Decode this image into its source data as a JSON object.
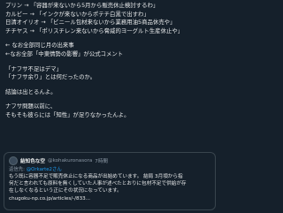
{
  "post": {
    "lines": [
      "プリン → 「容器が来ないから5月から販売休止検討するわ」",
      "カルビー → 「インクが来ないからポテチ白黒で出すわ」",
      "日清オイリオ → 「ビニール包材来ないから業務用油5商品休売や」",
      "チチヤス → 「ポリスチレン来ないから脅威的ヨーグルト生産休止や」",
      "",
      "← なお全部同じ月の出来事",
      "←なお全部「中東情勢の影響」が公式コメント",
      "",
      "「ナフサ不足はデマ」",
      "「ナフサ余り」とは何だったのか。",
      "",
      "結論は出とるんよ。",
      "",
      "ナフサ問題以前に、",
      "そもそも彼らには「知性」が足りなかったんよ。"
    ]
  },
  "quote": {
    "name": "結知色な空",
    "handle": "@kohakuronasora",
    "time": "7時間",
    "reply_prefix": "返信先:",
    "reply_to": "@Orkarte2さん",
    "body": [
      "もう既に容器不足で販売休止になる商品が出始めています。 結局 3月頃から指",
      "何だと言われても原料を無くしていた人事が述べたとおりに包材不足で供給が存",
      "在しなくなるという正にその状況になっています。",
      "chugoku-np.co.jp/articles/-/833..."
    ]
  }
}
